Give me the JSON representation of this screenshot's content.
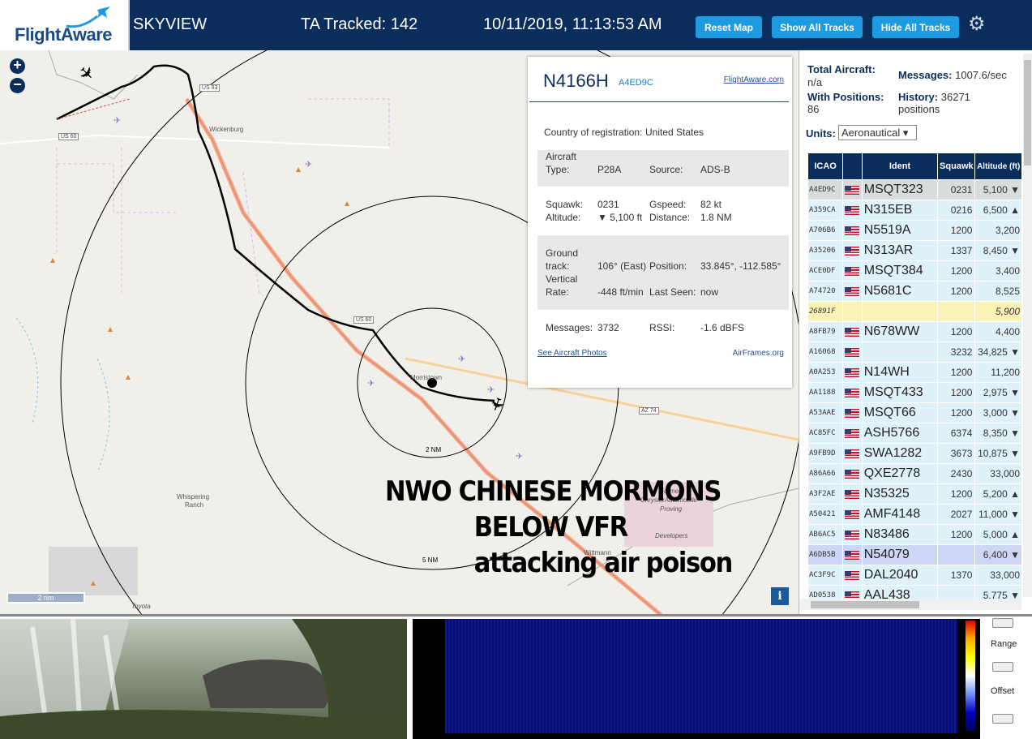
{
  "header": {
    "logo_text": "FlightAware",
    "app_name": "SKYVIEW",
    "ta_tracked": "TA Tracked: 142",
    "timestamp": "10/11/2019, 11:13:53 AM",
    "reset_map": "Reset Map",
    "show_all_tracks": "Show All Tracks",
    "hide_all_tracks": "Hide All Tracks",
    "settings_icon": "gear-icon"
  },
  "map": {
    "zoom_in": "+",
    "zoom_out": "−",
    "labels": {
      "wickenburg": "Wickenburg",
      "morristown": "Morristown",
      "whispering": "Whispering",
      "ranch": "Ranch",
      "former": "Former",
      "chrysler": "ChryslerAutomobile",
      "proving": "Proving",
      "developers": "Developers",
      "wittmann": "Wittmann",
      "toyota": "Toyota",
      "us93": "US 93",
      "us60a": "US 60",
      "us60b": "US 60",
      "az74": "AZ 74",
      "ring5": "5 NM",
      "ring_inner": "2 NM"
    },
    "overlay_text": [
      "NWO CHINESE MORMONS",
      "BELOW VFR",
      "attacking air poison"
    ],
    "scale_label": "2 nm",
    "info_button": "i"
  },
  "popup": {
    "registration": "N4166H",
    "hex": "A4ED9C",
    "flightaware_link": "FlightAware.com",
    "country_label": "Country of registration:",
    "country_value": "United States",
    "aircraft_type_label_1": "Aircraft",
    "aircraft_type_label_2": "Type:",
    "aircraft_type_value": "P28A",
    "source_label": "Source:",
    "source_value": "ADS-B",
    "squawk_label": "Squawk:",
    "squawk_value": "0231",
    "gspeed_label": "Gspeed:",
    "gspeed_value": "82 kt",
    "altitude_label": "Altitude:",
    "altitude_value": "▼ 5,100 ft",
    "distance_label": "Distance:",
    "distance_value": "1.8 NM",
    "ground_track_label_1": "Ground",
    "ground_track_label_2": "track:",
    "ground_track_value": "106° (East)",
    "position_label": "Position:",
    "position_value": "33.845°, -112.585°",
    "vertical_rate_label_1": "Vertical",
    "vertical_rate_label_2": "Rate:",
    "vertical_rate_value": "-448 ft/min",
    "last_seen_label": "Last Seen:",
    "last_seen_value": "now",
    "messages_label": "Messages:",
    "messages_value": "3732",
    "rssi_label": "RSSI:",
    "rssi_value": "-1.6 dBFS",
    "photos_link": "See Aircraft Photos",
    "airframes_link": "AirFrames.org"
  },
  "panel": {
    "total_aircraft_label": "Total Aircraft:",
    "total_aircraft_value": "n/a",
    "messages_label": "Messages:",
    "messages_value": "1007.6/sec",
    "with_positions_label": "With Positions:",
    "with_positions_value": "86",
    "history_label": "History:",
    "history_value": "36271",
    "history_unit": "positions",
    "units_label": "Units:",
    "units_value": "Aeronautical ▾",
    "columns": [
      "ICAO",
      "",
      "Ident",
      "Squawk",
      "Altitude (ft)"
    ],
    "rows": [
      {
        "icao": "A4ED9C",
        "flag": true,
        "ident": "MSQT323",
        "squawk": "0231",
        "alt": "5,100 ▼",
        "style": "sel"
      },
      {
        "icao": "A359CA",
        "flag": true,
        "ident": "N315EB",
        "squawk": "0216",
        "alt": "6,500 ▲",
        "style": ""
      },
      {
        "icao": "A706B6",
        "flag": true,
        "ident": "N5519A",
        "squawk": "1200",
        "alt": "3,200",
        "style": ""
      },
      {
        "icao": "A35206",
        "flag": true,
        "ident": "N313AR",
        "squawk": "1337",
        "alt": "8,450 ▼",
        "style": ""
      },
      {
        "icao": "ACE0DF",
        "flag": true,
        "ident": "MSQT384",
        "squawk": "1200",
        "alt": "3,400",
        "style": ""
      },
      {
        "icao": "A74720",
        "flag": true,
        "ident": "N5681C",
        "squawk": "1200",
        "alt": "8,525",
        "style": ""
      },
      {
        "icao": "26891F",
        "flag": false,
        "ident": "",
        "squawk": "",
        "alt": "5,900",
        "style": "yel"
      },
      {
        "icao": "A8FB79",
        "flag": true,
        "ident": "N678WW",
        "squawk": "1200",
        "alt": "4,400",
        "style": ""
      },
      {
        "icao": "A16068",
        "flag": true,
        "ident": "",
        "squawk": "3232",
        "alt": "34,825 ▼",
        "style": ""
      },
      {
        "icao": "A0A253",
        "flag": true,
        "ident": "N14WH",
        "squawk": "1200",
        "alt": "11,200",
        "style": ""
      },
      {
        "icao": "AA1188",
        "flag": true,
        "ident": "MSQT433",
        "squawk": "1200",
        "alt": "2,975 ▼",
        "style": ""
      },
      {
        "icao": "A53AAE",
        "flag": true,
        "ident": "MSQT66",
        "squawk": "1200",
        "alt": "3,000 ▼",
        "style": ""
      },
      {
        "icao": "AC85FC",
        "flag": true,
        "ident": "ASH5766",
        "squawk": "6374",
        "alt": "8,350 ▼",
        "style": ""
      },
      {
        "icao": "A9FB9D",
        "flag": true,
        "ident": "SWA1282",
        "squawk": "3673",
        "alt": "10,875 ▼",
        "style": ""
      },
      {
        "icao": "A86A66",
        "flag": true,
        "ident": "QXE2778",
        "squawk": "2430",
        "alt": "33,000",
        "style": ""
      },
      {
        "icao": "A3F2AE",
        "flag": true,
        "ident": "N35325",
        "squawk": "1200",
        "alt": "5,200 ▲",
        "style": ""
      },
      {
        "icao": "A50421",
        "flag": true,
        "ident": "AMF4148",
        "squawk": "2027",
        "alt": "11,000 ▼",
        "style": ""
      },
      {
        "icao": "AB6AC5",
        "flag": true,
        "ident": "N83486",
        "squawk": "1200",
        "alt": "5,000 ▲",
        "style": ""
      },
      {
        "icao": "A6DB5B",
        "flag": true,
        "ident": "N54079",
        "squawk": "",
        "alt": "6,400 ▼",
        "style": "blu"
      },
      {
        "icao": "AC3F9C",
        "flag": true,
        "ident": "DAL2040",
        "squawk": "1370",
        "alt": "33,000",
        "style": ""
      },
      {
        "icao": "AD0538",
        "flag": true,
        "ident": "AAL438",
        "squawk": "",
        "alt": "5,775 ▼",
        "style": ""
      }
    ]
  },
  "bottom": {
    "range_label": "Range",
    "offset_label": "Offset"
  },
  "colors": {
    "header_bg": "#0b2d5c",
    "button_bg": "#1e9be0",
    "table_row": "#dff1f9",
    "table_selected": "#d9dcdd"
  }
}
